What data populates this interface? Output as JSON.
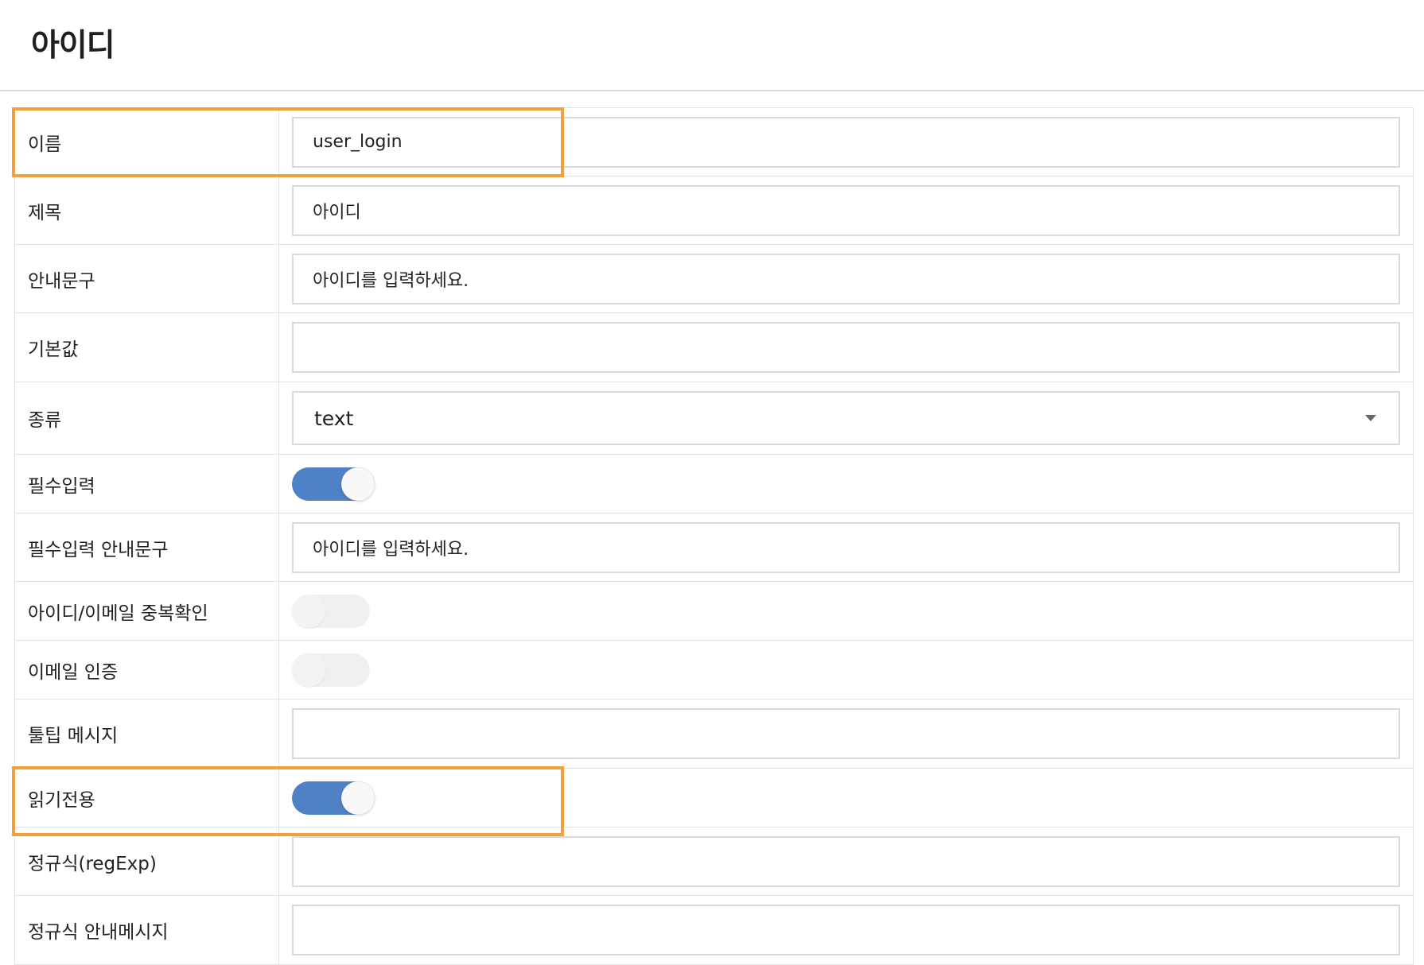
{
  "page": {
    "title": "아이디"
  },
  "fields": {
    "name": {
      "label": "이름",
      "value": "user_login"
    },
    "title": {
      "label": "제목",
      "value": "아이디"
    },
    "placeholder": {
      "label": "안내문구",
      "value": "아이디를 입력하세요."
    },
    "default_value": {
      "label": "기본값",
      "value": ""
    },
    "type": {
      "label": "종류",
      "value": "text"
    },
    "required": {
      "label": "필수입력",
      "enabled": true
    },
    "required_message": {
      "label": "필수입력 안내문구",
      "value": "아이디를 입력하세요."
    },
    "duplicate_check": {
      "label": "아이디/이메일 중복확인",
      "enabled": false
    },
    "email_verify": {
      "label": "이메일 인증",
      "enabled": false
    },
    "tooltip": {
      "label": "툴팁 메시지",
      "value": ""
    },
    "readonly": {
      "label": "읽기전용",
      "enabled": true
    },
    "regexp": {
      "label": "정규식(regExp)",
      "value": ""
    },
    "regexp_message": {
      "label": "정규식 안내메시지",
      "value": ""
    }
  },
  "colors": {
    "toggle_on": "#4f81c7",
    "toggle_off": "#f0f0f0",
    "highlight": "#f0a03c",
    "border": "#e2e2e2"
  },
  "icons": {
    "select_caret": "caret-down-icon"
  }
}
